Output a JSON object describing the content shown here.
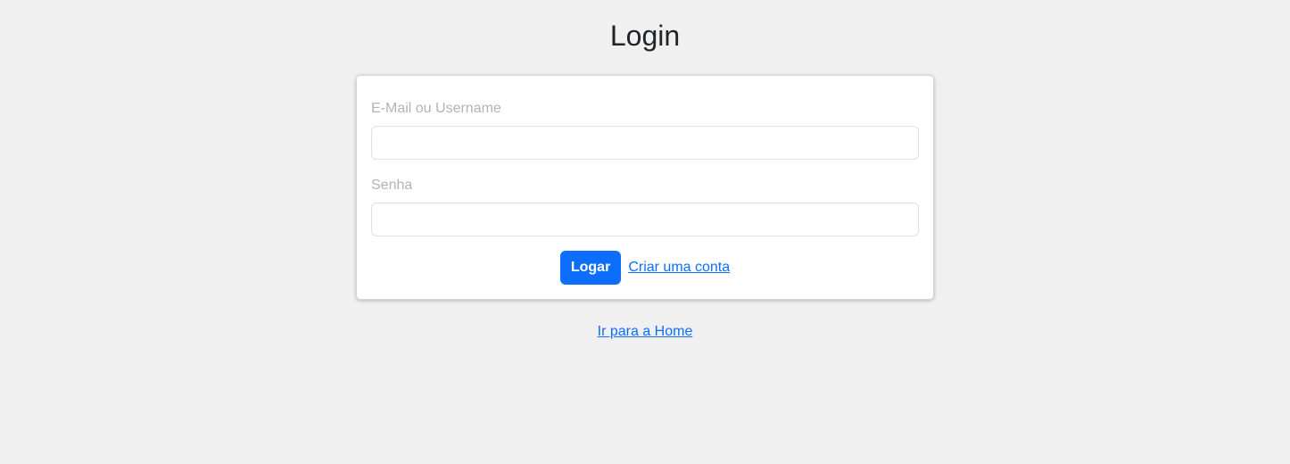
{
  "page": {
    "title": "Login"
  },
  "form": {
    "email_label": "E-Mail ou Username",
    "email_value": "",
    "password_label": "Senha",
    "password_value": "",
    "submit_label": "Logar",
    "register_link": "Criar uma conta"
  },
  "footer": {
    "home_link": "Ir para a Home"
  },
  "colors": {
    "background": "#f0f0f0",
    "accent": "#0d6efd",
    "label": "#b3b3b3"
  }
}
